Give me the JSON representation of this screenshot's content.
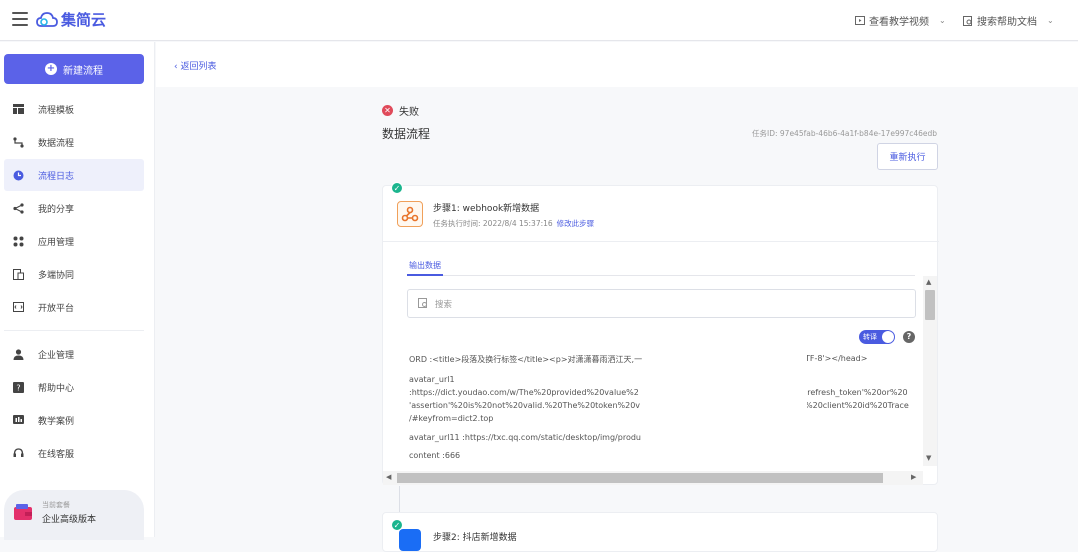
{
  "app": {
    "name": "集简云",
    "brand_color": "#4a5be0"
  },
  "header": {
    "video_link": "查看教学视频",
    "docs_link": "搜索帮助文档"
  },
  "sidebar": {
    "new_button": "新建流程",
    "items": [
      {
        "label": "流程模板",
        "icon": "template-icon"
      },
      {
        "label": "数据流程",
        "icon": "flow-icon"
      },
      {
        "label": "流程日志",
        "icon": "log-icon",
        "active": true
      },
      {
        "label": "我的分享",
        "icon": "share-icon"
      },
      {
        "label": "应用管理",
        "icon": "apps-icon"
      },
      {
        "label": "多端协同",
        "icon": "devices-icon"
      },
      {
        "label": "开放平台",
        "icon": "code-icon"
      },
      {
        "label": "企业管理",
        "icon": "user-icon"
      },
      {
        "label": "帮助中心",
        "icon": "help-icon"
      },
      {
        "label": "教学案例",
        "icon": "case-icon"
      },
      {
        "label": "在线客服",
        "icon": "support-icon"
      }
    ],
    "plan": {
      "caption": "当前套餐",
      "name": "企业高级版本"
    }
  },
  "page": {
    "back": "返回列表",
    "status": "失败",
    "title": "数据流程",
    "task_id": "任务ID: 97e45fab-46b6-4a1f-b84e-17e997c46edb",
    "rerun": "重新执行"
  },
  "step1": {
    "title": "步骤1: webhook新增数据",
    "time": "任务执行时间: 2022/8/4 15:37:16",
    "edit": "修改此步骤",
    "tab": "输出数据",
    "search_placeholder": "搜索",
    "toggle_label": "转译",
    "lines": {
      "l1a": "ORD :<title>段落及换行标签</title><p>对潇潇暮雨洒江天,一",
      "l1b": "TF-8'></head>",
      "l2": "avatar_url1",
      "l3a": ":https://dict.youdao.com/w/The%20provided%20value%2",
      "l3b": "'refresh_token'%20or%20",
      "l4a": "'assertion'%20is%20not%20valid.%20The%20token%20v",
      "l4b": "%20client%20id%20Trace",
      "l5": "/#keyfrom=dict2.top",
      "l6": "avatar_url11 :https://txc.qq.com/static/desktop/img/produ",
      "l7": "content :666"
    }
  },
  "step2": {
    "title": "步骤2: 抖店新增数据"
  }
}
